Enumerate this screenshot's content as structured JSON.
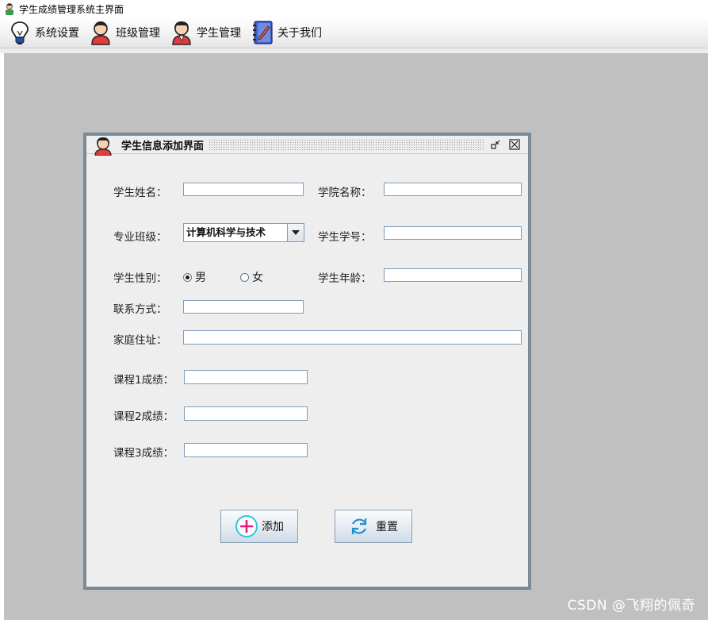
{
  "app": {
    "title": "学生成绩管理系统主界面"
  },
  "menu": [
    {
      "label": "系统设置",
      "icon": "lightbulb-icon"
    },
    {
      "label": "班级管理",
      "icon": "user-icon"
    },
    {
      "label": "学生管理",
      "icon": "student-icon"
    },
    {
      "label": "关于我们",
      "icon": "notebook-icon"
    }
  ],
  "frame": {
    "title": "学生信息添加界面",
    "form": {
      "student_name_label": "学生姓名：",
      "student_name_value": "",
      "college_label": "学院名称：",
      "college_value": "",
      "class_label": "专业班级：",
      "class_selected": "计算机科学与技术",
      "student_id_label": "学生学号：",
      "student_id_value": "",
      "gender_label": "学生性别：",
      "gender_options": [
        "男",
        "女"
      ],
      "gender_selected": "男",
      "age_label": "学生年龄：",
      "age_value": "",
      "contact_label": "联系方式：",
      "contact_value": "",
      "address_label": "家庭住址：",
      "address_value": "",
      "course1_label": "课程1成绩：",
      "course1_value": "",
      "course2_label": "课程2成绩：",
      "course2_value": "",
      "course3_label": "课程3成绩：",
      "course3_value": ""
    },
    "buttons": {
      "add": "添加",
      "reset": "重置"
    }
  },
  "watermark": "CSDN @飞翔的佩奇",
  "colors": {
    "desktop": "#c0c0c0",
    "frame_border": "#7a8a97",
    "add_icon": "#e2197a",
    "reset_icon": "#1f8fd1"
  }
}
